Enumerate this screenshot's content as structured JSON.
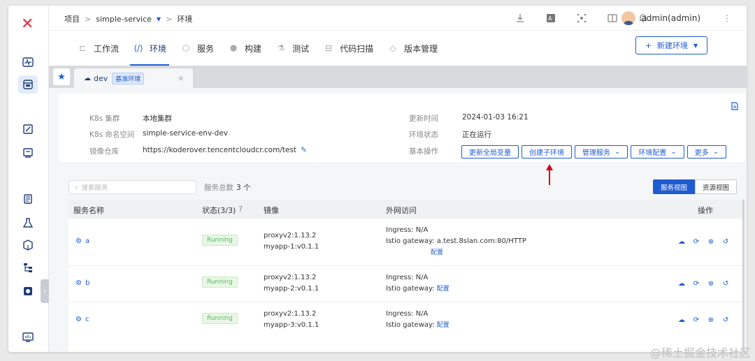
{
  "breadcrumb": {
    "project": "项目",
    "service": "simple-service",
    "page": "环境"
  },
  "user": {
    "name": "admin(admin)"
  },
  "tabs": [
    {
      "label": "工作流",
      "icon": "workflow-icon"
    },
    {
      "label": "环境",
      "icon": "environment-icon"
    },
    {
      "label": "服务",
      "icon": "service-icon"
    },
    {
      "label": "构建",
      "icon": "build-icon"
    },
    {
      "label": "测试",
      "icon": "test-icon"
    },
    {
      "label": "代码扫描",
      "icon": "scan-icon"
    },
    {
      "label": "版本管理",
      "icon": "version-icon"
    }
  ],
  "new_env_button": "新建环境",
  "env_tab": {
    "name": "dev",
    "badge": "基准环境"
  },
  "info": {
    "cluster_label": "K8s 集群",
    "cluster_value": "本地集群",
    "namespace_label": "K8s 命名空间",
    "namespace_value": "simple-service-env-dev",
    "registry_label": "镜像仓库",
    "registry_value": "https://koderover.tencentcloudcr.com/test",
    "updated_label": "更新时间",
    "updated_value": "2024-01-03 16:21",
    "status_label": "环境状态",
    "status_value": "正在运行",
    "ops_label": "基本操作"
  },
  "ops": {
    "update_vars": "更新全局变量",
    "create_sub": "创建子环境",
    "manage_svc": "管理服务",
    "env_config": "环境配置",
    "more": "更多"
  },
  "search": {
    "placeholder": "搜索服务"
  },
  "service_count": {
    "label": "服务总数",
    "value": "3 个"
  },
  "views": {
    "service": "服务视图",
    "resource": "资源视图"
  },
  "table": {
    "headers": {
      "name": "服务名称",
      "status": "状态(3/3)",
      "image": "镜像",
      "external": "外网访问",
      "actions": "操作"
    },
    "rows": [
      {
        "name": "a",
        "status": "Running",
        "images": [
          "proxyv2:1.13.2",
          "myapp-1:v0.1.1"
        ],
        "ingress": "Ingress: N/A",
        "istio": "Istio gateway: a.test.8slan.com:80/HTTP",
        "config": "配置"
      },
      {
        "name": "b",
        "status": "Running",
        "images": [
          "proxyv2:1.13.2",
          "myapp-2:v0.1.1"
        ],
        "ingress": "Ingress: N/A",
        "istio": "Istio gateway:",
        "config": "配置"
      },
      {
        "name": "c",
        "status": "Running",
        "images": [
          "proxyv2:1.13.2",
          "myapp-3:v0.1.1"
        ],
        "ingress": "Ingress: N/A",
        "istio": "Istio gateway:",
        "config": "配置"
      }
    ]
  },
  "watermark": "@稀土掘金技术社区",
  "colors": {
    "accent": "#1f5ccf",
    "brand": "#e03148",
    "running": "#5cb85c"
  }
}
